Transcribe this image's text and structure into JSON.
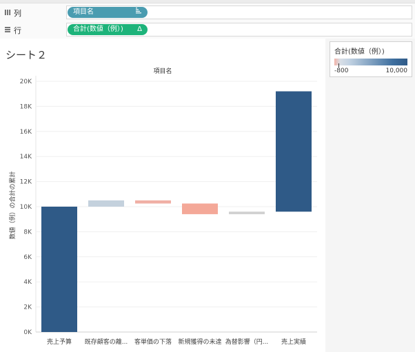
{
  "shelves": {
    "columns": {
      "label": "列",
      "icon": "columns-icon",
      "pill": {
        "text": "項目名",
        "icon": "sort-descending-icon",
        "color": "#4a9cb0"
      }
    },
    "rows": {
      "label": "行",
      "icon": "rows-icon",
      "pill": {
        "text": "合計(数値（例）)",
        "icon": "delta-icon",
        "color": "#1db37a"
      }
    }
  },
  "sheet": {
    "title": "シート２",
    "header": "項目名"
  },
  "legend": {
    "title": "合計(数値（例）)",
    "min": "-800",
    "max": "10,000"
  },
  "chart_data": {
    "type": "bar",
    "subtype": "waterfall",
    "title": "",
    "xlabel": "項目名",
    "ylabel": "数値（例）の合計の累計",
    "ylim": [
      0,
      20000
    ],
    "yticks": [
      0,
      2000,
      4000,
      6000,
      8000,
      10000,
      12000,
      14000,
      16000,
      18000,
      20000
    ],
    "ytick_labels": [
      "0K",
      "2K",
      "4K",
      "6K",
      "8K",
      "10K",
      "12K",
      "14K",
      "16K",
      "18K",
      "20K"
    ],
    "categories": [
      "売上予算",
      "既存顧客の離...",
      "客単価の下落",
      "新規獲得の未達",
      "為替影響（円...",
      "売上実績"
    ],
    "bars": [
      {
        "start": 0,
        "end": 10000,
        "value": 10000,
        "color": "#2f5a87"
      },
      {
        "start": 10000,
        "end": 10500,
        "value": 500,
        "color": "#c4d1dd"
      },
      {
        "start": 10500,
        "end": 10250,
        "value": -250,
        "color": "#f0b0a5"
      },
      {
        "start": 10250,
        "end": 9400,
        "value": -850,
        "color": "#f4a898"
      },
      {
        "start": 9400,
        "end": 9600,
        "value": 200,
        "color": "#d0d0d0"
      },
      {
        "start": 9600,
        "end": 19200,
        "value": 9600,
        "color": "#2f5a87"
      }
    ],
    "grid": true,
    "legend_placement": "top-right"
  }
}
